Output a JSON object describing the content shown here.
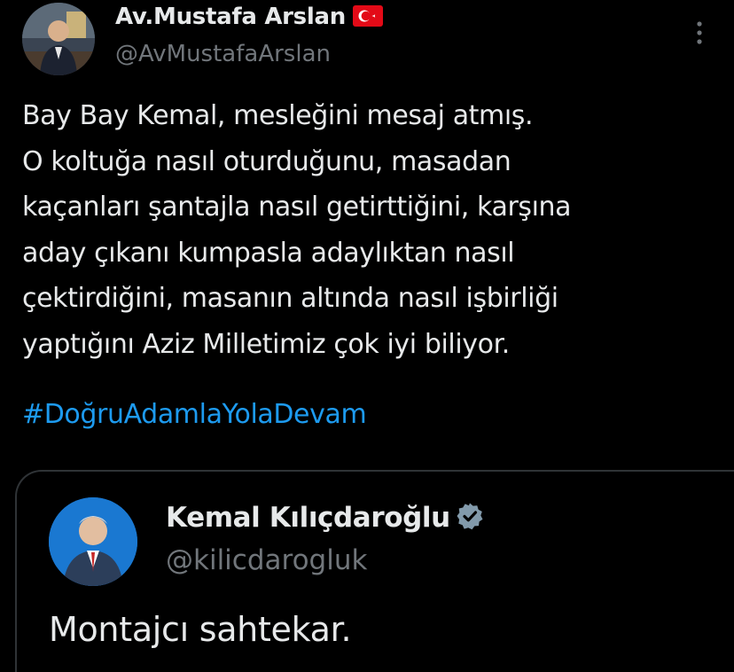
{
  "tweet": {
    "author": {
      "name": "Av.Mustafa Arslan",
      "handle": "@AvMustafaArslan",
      "flag_icon": "turkey-flag-icon",
      "avatar_icon": "profile-photo"
    },
    "more_icon": "more-options-icon",
    "body_lines": [
      "Bay Bay Kemal, mesleğini mesaj atmış.",
      "O koltuğa nasıl oturduğunu, masadan",
      "kaçanları şantajla nasıl getirttiğini, karşına",
      "aday çıkanı kumpasla adaylıktan nasıl",
      "çektirdiğini, masanın altında nasıl işbirliği",
      "yaptığını Aziz Milletimiz çok iyi biliyor."
    ],
    "hashtag": "#DoğruAdamlaYolaDevam"
  },
  "quoted_tweet": {
    "author": {
      "name": "Kemal Kılıçdaroğlu",
      "handle": "@kilicdarogluk",
      "verified_icon": "verified-badge-icon",
      "avatar_icon": "profile-photo"
    },
    "text": "Montajcı sahtekar."
  },
  "colors": {
    "background": "#000000",
    "primary_text": "#e7e9ea",
    "secondary_text": "#71767b",
    "hashtag": "#1d9bf0",
    "verified_badge": "#829aab",
    "card_border": "#2f3336"
  }
}
